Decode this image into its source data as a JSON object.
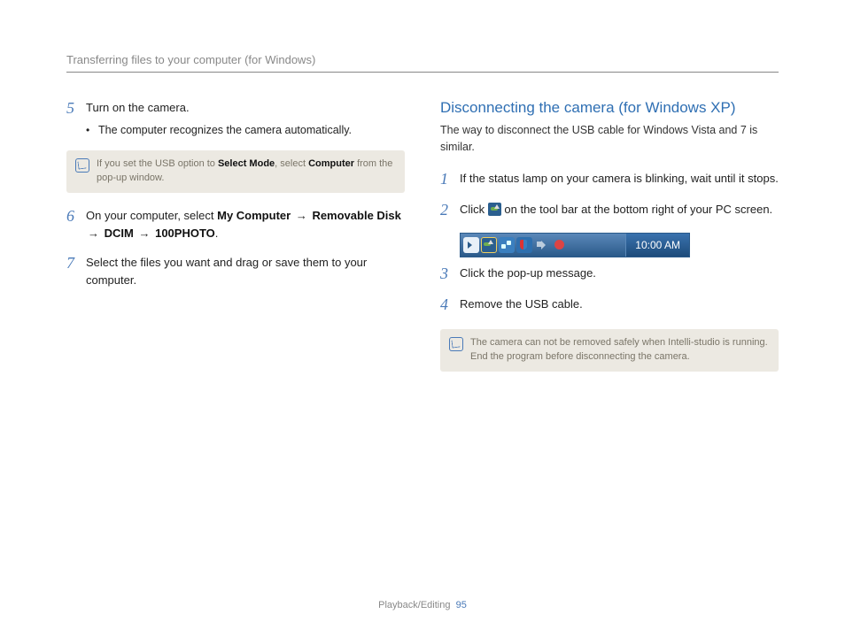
{
  "header": "Transferring files to your computer (for Windows)",
  "left": {
    "step5": {
      "num": "5",
      "text": "Turn on the camera.",
      "bullet": "The computer recognizes the camera automatically."
    },
    "note": {
      "pre": "If you set the USB option to ",
      "b1": "Select Mode",
      "mid": ", select ",
      "b2": "Computer",
      "post": " from the pop-up window."
    },
    "step6": {
      "num": "6",
      "pre": "On your computer, select ",
      "p1": "My Computer",
      "p2": "Removable Disk",
      "p3": "DCIM",
      "p4": "100PHOTO",
      "arrow": "→",
      "end": "."
    },
    "step7": {
      "num": "7",
      "text": "Select the files you want and drag or save them to your computer."
    }
  },
  "right": {
    "title": "Disconnecting the camera (for Windows XP)",
    "sub": "The way to disconnect the USB cable for Windows Vista and 7 is similar.",
    "step1": {
      "num": "1",
      "text": "If the status lamp on your camera is blinking, wait until it stops."
    },
    "step2": {
      "num": "2",
      "pre": "Click ",
      "post": " on the tool bar at the bottom right of your PC screen."
    },
    "tray_time": "10:00 AM",
    "step3": {
      "num": "3",
      "text": "Click the pop-up message."
    },
    "step4": {
      "num": "4",
      "text": "Remove the USB cable."
    },
    "note": "The camera can not be removed safely when Intelli-studio is running. End the program before disconnecting the camera."
  },
  "footer": {
    "section": "Playback/Editing",
    "page": "95"
  }
}
